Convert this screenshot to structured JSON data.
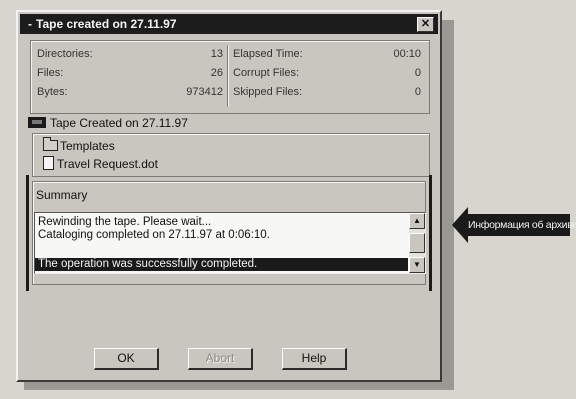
{
  "dialog": {
    "title_icon": "-",
    "title": "Tape created on 27.11.97",
    "close_glyph": "✕"
  },
  "stats": {
    "left": [
      {
        "label": "Directories:",
        "value": "13"
      },
      {
        "label": "Files:",
        "value": "26"
      },
      {
        "label": "Bytes:",
        "value": "973412"
      }
    ],
    "right": [
      {
        "label": "Elapsed Time:",
        "value": "00:10"
      },
      {
        "label": "Corrupt Files:",
        "value": "0"
      },
      {
        "label": "Skipped Files:",
        "value": "0"
      }
    ]
  },
  "tape": {
    "label": "Tape Created on 27.11.97",
    "icon": "tape-icon"
  },
  "tree": [
    {
      "label": "Templates",
      "icon": "folder-icon"
    },
    {
      "label": "Travel Request.dot",
      "icon": "file-icon"
    }
  ],
  "summary": {
    "label": "Summary",
    "lines": [
      "Rewinding the tape. Please wait...",
      "Cataloging completed on 27.11.97 at 0:06:10.",
      "",
      "The operation was successfully completed."
    ],
    "selected_index": 3
  },
  "buttons": {
    "ok": "OK",
    "abort": "Abort",
    "help": "Help"
  },
  "callout": {
    "label": "Информация об архиве"
  },
  "colors": {
    "dialog_bg": "#c9c6bf",
    "titlebar": "#1c1c1c",
    "selection": "#1a1a1a"
  }
}
